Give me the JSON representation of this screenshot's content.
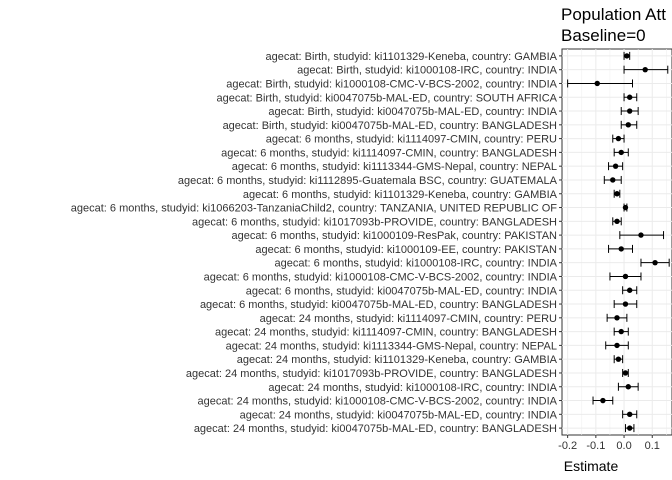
{
  "chart_data": {
    "type": "forest",
    "title_line1": "Population Att",
    "title_line2": "Baseline=0",
    "xlabel": "Estimate",
    "ylabel": "",
    "xlim": [
      -0.22,
      0.17
    ],
    "xticks": [
      -0.2,
      -0.1,
      0.0,
      0.1
    ],
    "xtick_labels": [
      "-0.2",
      "-0.1",
      "0.0",
      "0.1"
    ],
    "grid": true,
    "rows": [
      {
        "label": "agecat: Birth, studyid: ki1101329-Keneba, country: GAMBIA",
        "estimate": 0.01,
        "lower": 0.0,
        "upper": 0.02
      },
      {
        "label": "agecat: Birth, studyid: ki1000108-IRC, country: INDIA",
        "estimate": 0.075,
        "lower": 0.0,
        "upper": 0.155
      },
      {
        "label": "agecat: Birth, studyid: ki1000108-CMC-V-BCS-2002, country: INDIA",
        "estimate": -0.095,
        "lower": -0.2,
        "upper": 0.03
      },
      {
        "label": "agecat: Birth, studyid: ki0047075b-MAL-ED, country: SOUTH AFRICA",
        "estimate": 0.02,
        "lower": 0.0,
        "upper": 0.045
      },
      {
        "label": "agecat: Birth, studyid: ki0047075b-MAL-ED, country: INDIA",
        "estimate": 0.02,
        "lower": -0.01,
        "upper": 0.05
      },
      {
        "label": "agecat: Birth, studyid: ki0047075b-MAL-ED, country: BANGLADESH",
        "estimate": 0.015,
        "lower": -0.01,
        "upper": 0.045
      },
      {
        "label": "agecat: 6 months, studyid: ki1114097-CMIN, country: PERU",
        "estimate": -0.02,
        "lower": -0.04,
        "upper": 0.0
      },
      {
        "label": "agecat: 6 months, studyid: ki1114097-CMIN, country: BANGLADESH",
        "estimate": -0.01,
        "lower": -0.035,
        "upper": 0.015
      },
      {
        "label": "agecat: 6 months, studyid: ki1113344-GMS-Nepal, country: NEPAL",
        "estimate": -0.03,
        "lower": -0.055,
        "upper": -0.005
      },
      {
        "label": "agecat: 6 months, studyid: ki1112895-Guatemala BSC, country: GUATEMALA",
        "estimate": -0.04,
        "lower": -0.07,
        "upper": -0.01
      },
      {
        "label": "agecat: 6 months, studyid: ki1101329-Keneba, country: GAMBIA",
        "estimate": -0.025,
        "lower": -0.035,
        "upper": -0.015
      },
      {
        "label": "agecat: 6 months, studyid: ki1066203-TanzaniaChild2, country: TANZANIA, UNITED REPUBLIC OF",
        "estimate": 0.005,
        "lower": 0.0,
        "upper": 0.01
      },
      {
        "label": "agecat: 6 months, studyid: ki1017093b-PROVIDE, country: BANGLADESH",
        "estimate": -0.025,
        "lower": -0.04,
        "upper": -0.01
      },
      {
        "label": "agecat: 6 months, studyid: ki1000109-ResPak, country: PAKISTAN",
        "estimate": 0.06,
        "lower": -0.015,
        "upper": 0.14
      },
      {
        "label": "agecat: 6 months, studyid: ki1000109-EE, country: PAKISTAN",
        "estimate": -0.01,
        "lower": -0.055,
        "upper": 0.03
      },
      {
        "label": "agecat: 6 months, studyid: ki1000108-IRC, country: INDIA",
        "estimate": 0.11,
        "lower": 0.06,
        "upper": 0.16
      },
      {
        "label": "agecat: 6 months, studyid: ki1000108-CMC-V-BCS-2002, country: INDIA",
        "estimate": 0.005,
        "lower": -0.05,
        "upper": 0.06
      },
      {
        "label": "agecat: 6 months, studyid: ki0047075b-MAL-ED, country: INDIA",
        "estimate": 0.02,
        "lower": -0.005,
        "upper": 0.045
      },
      {
        "label": "agecat: 6 months, studyid: ki0047075b-MAL-ED, country: BANGLADESH",
        "estimate": 0.005,
        "lower": -0.035,
        "upper": 0.045
      },
      {
        "label": "agecat: 24 months, studyid: ki1114097-CMIN, country: PERU",
        "estimate": -0.025,
        "lower": -0.06,
        "upper": 0.01
      },
      {
        "label": "agecat: 24 months, studyid: ki1114097-CMIN, country: BANGLADESH",
        "estimate": -0.01,
        "lower": -0.035,
        "upper": 0.015
      },
      {
        "label": "agecat: 24 months, studyid: ki1113344-GMS-Nepal, country: NEPAL",
        "estimate": -0.025,
        "lower": -0.065,
        "upper": 0.015
      },
      {
        "label": "agecat: 24 months, studyid: ki1101329-Keneba, country: GAMBIA",
        "estimate": -0.02,
        "lower": -0.035,
        "upper": -0.005
      },
      {
        "label": "agecat: 24 months, studyid: ki1017093b-PROVIDE, country: BANGLADESH",
        "estimate": 0.005,
        "lower": -0.005,
        "upper": 0.015
      },
      {
        "label": "agecat: 24 months, studyid: ki1000108-IRC, country: INDIA",
        "estimate": 0.015,
        "lower": -0.02,
        "upper": 0.05
      },
      {
        "label": "agecat: 24 months, studyid: ki1000108-CMC-V-BCS-2002, country: INDIA",
        "estimate": -0.075,
        "lower": -0.11,
        "upper": -0.04
      },
      {
        "label": "agecat: 24 months, studyid: ki0047075b-MAL-ED, country: INDIA",
        "estimate": 0.02,
        "lower": -0.005,
        "upper": 0.045
      },
      {
        "label": "agecat: 24 months, studyid: ki0047075b-MAL-ED, country: BANGLADESH",
        "estimate": 0.02,
        "lower": 0.005,
        "upper": 0.035
      }
    ]
  }
}
